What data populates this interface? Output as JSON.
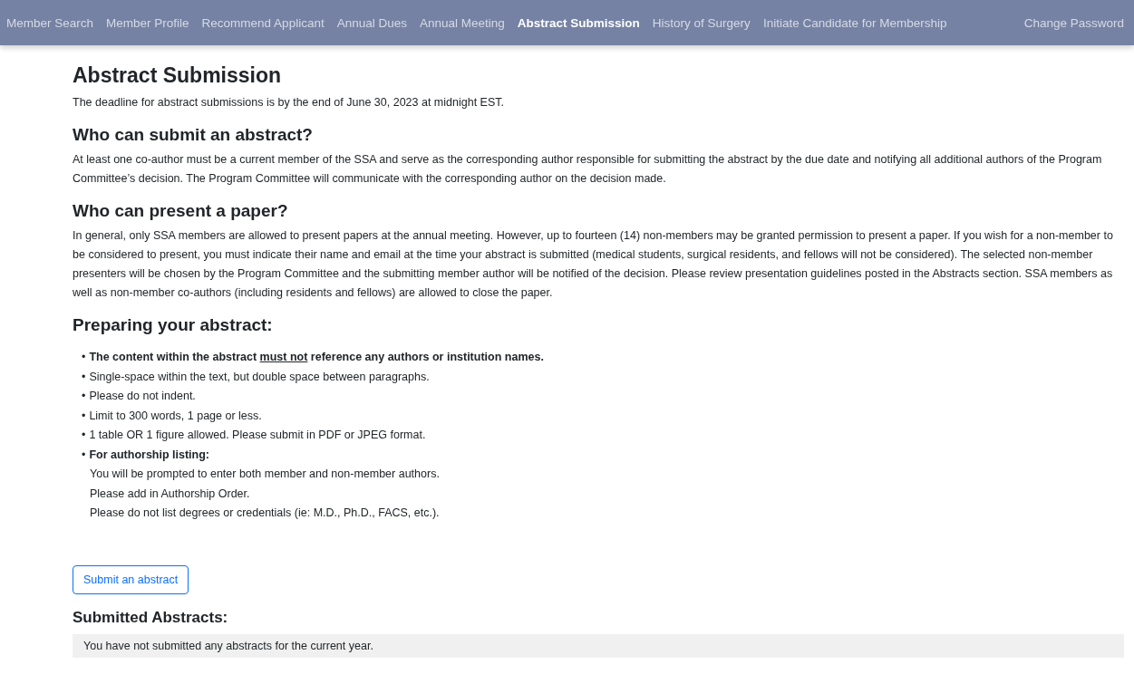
{
  "nav": {
    "items": [
      {
        "label": "Member Search",
        "selected": false
      },
      {
        "label": "Member Profile",
        "selected": false
      },
      {
        "label": "Recommend Applicant",
        "selected": false
      },
      {
        "label": "Annual Dues",
        "selected": false
      },
      {
        "label": "Annual Meeting",
        "selected": false
      },
      {
        "label": "Abstract Submission",
        "selected": true
      },
      {
        "label": "History of Surgery",
        "selected": false
      },
      {
        "label": "Initiate Candidate for Membership",
        "selected": false
      }
    ],
    "right_link": "Change Password"
  },
  "title": "Abstract Submission",
  "deadline": "The deadline for abstract submissions is by the end of June 30, 2023 at midnight EST.",
  "sections": [
    {
      "heading": "Who can submit an abstract?",
      "text": "At least one co-author must be a current member of the SSA and serve as the corresponding author responsible for submitting the abstract by the due date and notifying all additional authors of the Program Committee’s decision. The Program Committee will communicate with the corresponding author on the decision made."
    },
    {
      "heading": "Who can present a paper?",
      "text": "In general, only SSA members are allowed to present papers at the annual meeting. However, up to fourteen (14) non-members may be granted permission to present a paper. If you wish for a non-member to be considered to present, you must indicate their name and email at the time your abstract is submitted (medical students, surgical residents, and fellows will not be considered). The selected non-member presenters will be chosen by the Program Committee and the submitting member author will be notified of the decision. Please review presentation guidelines posted in the Abstracts section. SSA members as well as non-member co-authors (including residents and fellows) are allowed to close the paper."
    }
  ],
  "preparing": {
    "heading": "Preparing your abstract:",
    "items": [
      {
        "kind": "bullet",
        "bold": true,
        "parts": [
          {
            "text": "The content within the abstract ",
            "underline": false
          },
          {
            "text": "must not",
            "underline": true
          },
          {
            "text": " reference any authors or institution names.",
            "underline": false
          }
        ]
      },
      {
        "kind": "bullet",
        "bold": false,
        "parts": [
          {
            "text": "Single-space within the text, but double space between paragraphs.",
            "underline": false
          }
        ]
      },
      {
        "kind": "bullet",
        "bold": false,
        "parts": [
          {
            "text": "Please do not indent.",
            "underline": false
          }
        ]
      },
      {
        "kind": "bullet",
        "bold": false,
        "parts": [
          {
            "text": "Limit to 300 words, 1 page or less.",
            "underline": false
          }
        ]
      },
      {
        "kind": "bullet",
        "bold": false,
        "parts": [
          {
            "text": "1 table OR 1 figure allowed. Please submit in PDF or JPEG format.",
            "underline": false
          }
        ]
      },
      {
        "kind": "bullet",
        "bold": true,
        "parts": [
          {
            "text": "For authorship listing:",
            "underline": false
          }
        ]
      },
      {
        "kind": "sub",
        "bold": false,
        "parts": [
          {
            "text": "You will be prompted to enter both member and non-member authors.",
            "underline": false
          }
        ]
      },
      {
        "kind": "sub",
        "bold": false,
        "parts": [
          {
            "text": "Please add in Authorship Order.",
            "underline": false
          }
        ]
      },
      {
        "kind": "sub",
        "bold": false,
        "parts": [
          {
            "text": "Please do not list degrees or credentials (ie: M.D., Ph.D., FACS, etc.).",
            "underline": false
          }
        ]
      }
    ],
    "bullet": "•"
  },
  "submit_button": "Submit an abstract",
  "submitted": {
    "heading": "Submitted Abstracts:",
    "empty_message": "You have not submitted any abstracts for the current year."
  }
}
